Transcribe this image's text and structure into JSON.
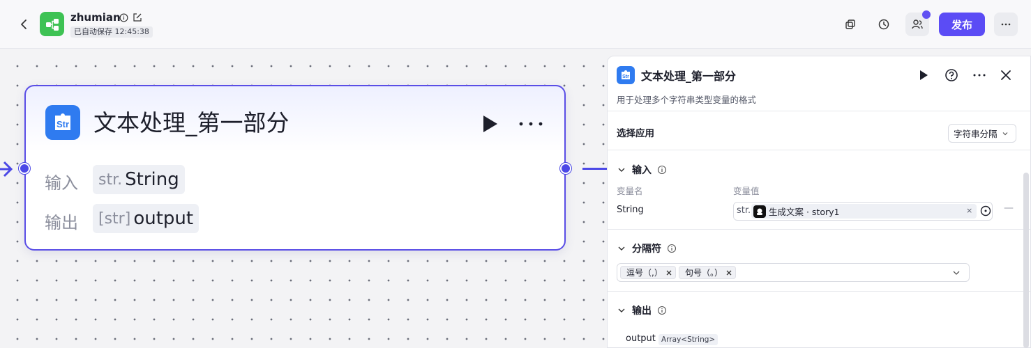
{
  "header": {
    "app_name": "zhumian",
    "autosave": "已自动保存 12:45:38",
    "publish_label": "发布",
    "icons": [
      "back-icon",
      "workflow-icon",
      "info-icon",
      "edit-icon",
      "copy-icon",
      "history-icon",
      "collaborators-icon",
      "more-icon"
    ]
  },
  "node": {
    "title": "文本处理_第一部分",
    "icon_text": "Str",
    "input_label": "输入",
    "input_prefix": "str.",
    "input_value": "String",
    "output_label": "输出",
    "output_prefix": "[str]",
    "output_value": "output"
  },
  "panel": {
    "title": "文本处理_第一部分",
    "icon_text": "Str",
    "description": "用于处理多个字符串类型变量的格式",
    "select_app_label": "选择应用",
    "select_app_value": "字符串分隔",
    "input_section": "输入",
    "col_name": "变量名",
    "col_value": "变量值",
    "var_name": "String",
    "var_prefix": "str.",
    "var_ref": "生成文案 · story1",
    "var_clear": "×",
    "var_remove": "—",
    "separator_section": "分隔符",
    "separator_tags": [
      "逗号（,）",
      "句号（。）"
    ],
    "output_section": "输出",
    "output_name": "output",
    "output_type": "Array<String>"
  },
  "colors": {
    "accent": "#5b4cf5",
    "node_border": "#5a4ee6",
    "node_icon": "#2f7bf0",
    "app_logo": "#3ec254"
  }
}
